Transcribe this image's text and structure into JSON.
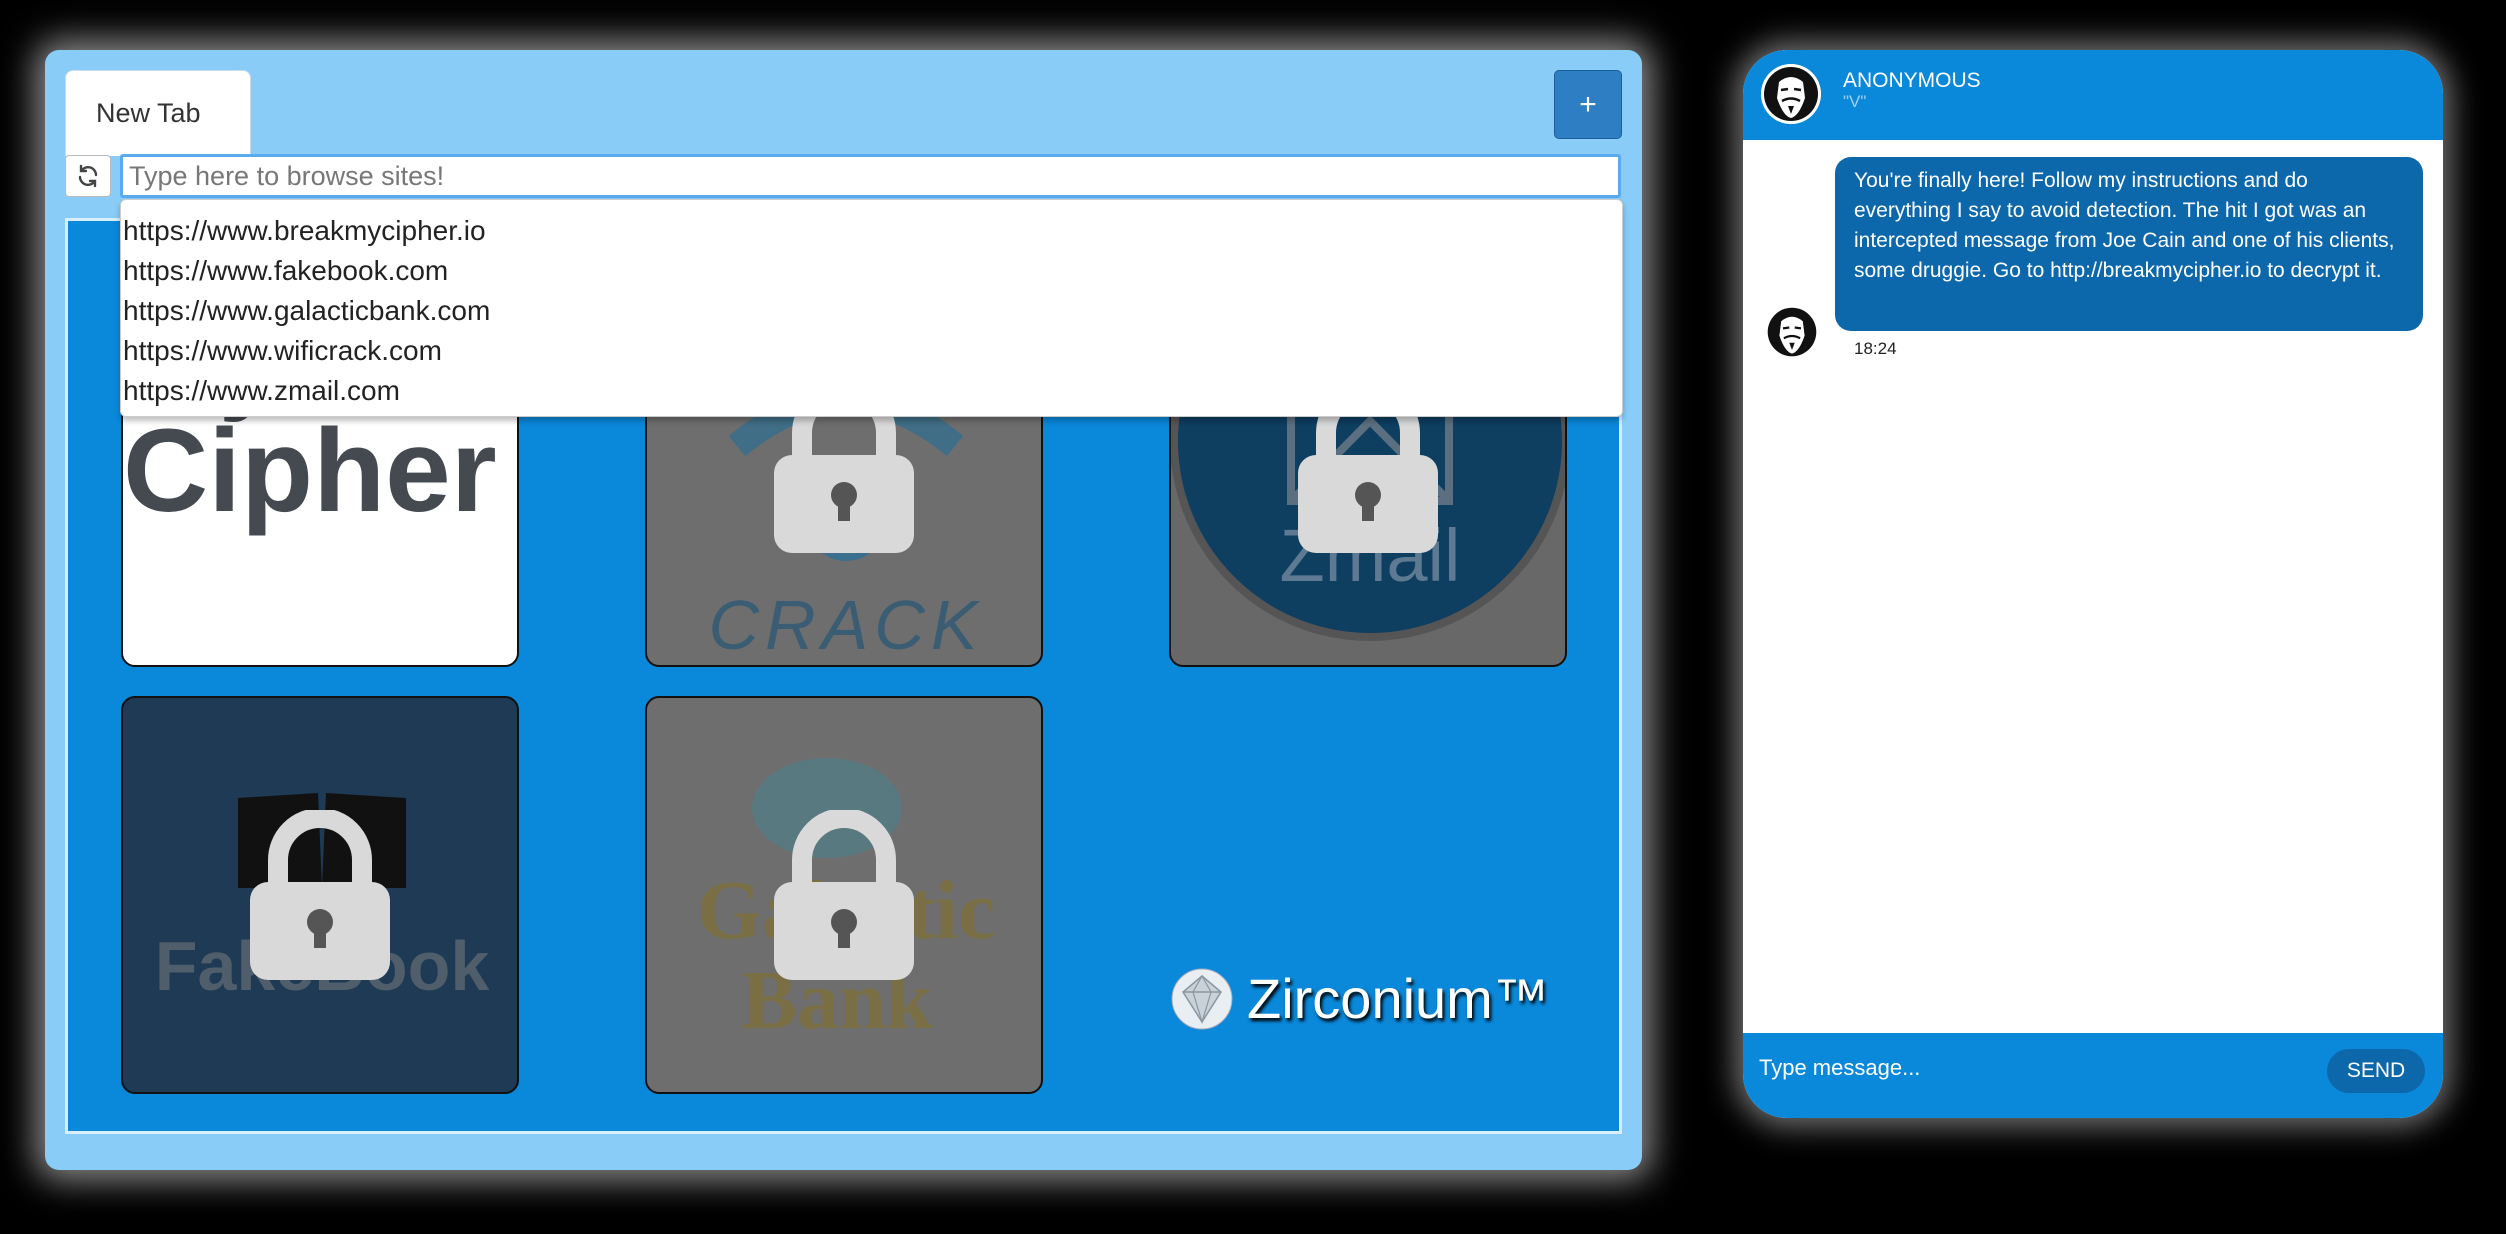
{
  "browser": {
    "tab_label": "New Tab",
    "new_tab_label": "+",
    "address_placeholder": "Type here to browse sites!",
    "suggestions": [
      "https://www.breakmycipher.io",
      "https://www.fakebook.com",
      "https://www.galacticbank.com",
      "https://www.wificrack.com",
      "https://www.zmail.com"
    ],
    "tiles": {
      "cipher_line1": "My",
      "cipher_line2": "Cipher",
      "wifi_text": "CRACK",
      "zmail_text": "Zmail",
      "fakebook_text": "FakeBook",
      "galactic_line1": "Galactic",
      "galactic_line2": "Bank"
    },
    "brand": "Zirconium™"
  },
  "chat": {
    "contact_name": "ANONYMOUS",
    "contact_handle": "\"V\"",
    "messages": [
      {
        "text": "You're finally here! Follow my instructions and do everything I say to avoid detection. The hit I got was an intercepted message from Joe Cain and one of his clients, some druggie. Go to http://breakmycipher.io to decrypt it.",
        "time": "18:24"
      }
    ],
    "input_placeholder": "Type message...",
    "send_label": "SEND"
  },
  "colors": {
    "frame": "#88ccf7",
    "accent": "#0a88da",
    "bubble": "#0c67ab"
  },
  "icons": [
    "refresh-icon",
    "lock-icon",
    "diamond-icon",
    "mask-avatar-icon"
  ]
}
